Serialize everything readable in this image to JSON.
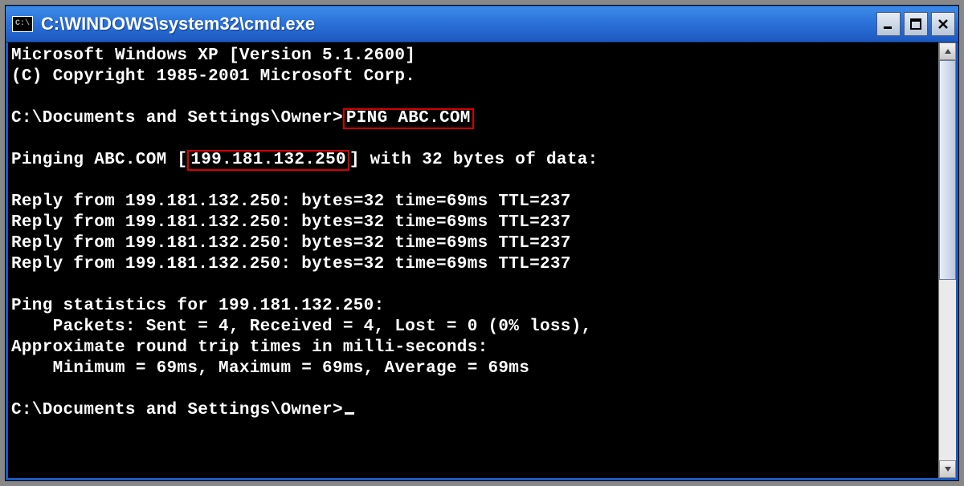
{
  "window": {
    "icon_label": "C:\\",
    "title": "C:\\WINDOWS\\system32\\cmd.exe"
  },
  "terminal": {
    "line_version": "Microsoft Windows XP [Version 5.1.2600]",
    "line_copyright": "(C) Copyright 1985-2001 Microsoft Corp.",
    "prompt1_pre": "C:\\Documents and Settings\\Owner>",
    "prompt1_cmd": "PING ABC.COM",
    "pinging_pre": "Pinging ABC.COM [",
    "pinging_ip": "199.181.132.250",
    "pinging_post": "] with 32 bytes of data:",
    "replies": [
      "Reply from 199.181.132.250: bytes=32 time=69ms TTL=237",
      "Reply from 199.181.132.250: bytes=32 time=69ms TTL=237",
      "Reply from 199.181.132.250: bytes=32 time=69ms TTL=237",
      "Reply from 199.181.132.250: bytes=32 time=69ms TTL=237"
    ],
    "stats_header": "Ping statistics for 199.181.132.250:",
    "stats_packets": "    Packets: Sent = 4, Received = 4, Lost = 0 (0% loss),",
    "stats_approx": "Approximate round trip times in milli-seconds:",
    "stats_times": "    Minimum = 69ms, Maximum = 69ms, Average = 69ms",
    "prompt2_pre": "C:\\Documents and Settings\\Owner>"
  }
}
